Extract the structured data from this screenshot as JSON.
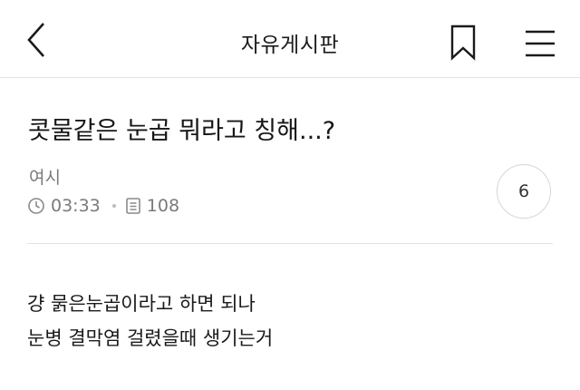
{
  "header": {
    "title": "자유게시판",
    "back_icon": "chevron-left-icon",
    "bookmark_icon": "bookmark-icon",
    "menu_icon": "hamburger-menu-icon"
  },
  "post": {
    "title": "콧물같은 눈곱 뭐라고 칭해...?",
    "author": "여시",
    "time": "03:33",
    "views": "108",
    "comment_count": "6",
    "body_lines": [
      "걍 묽은눈곱이라고 하면 되나",
      "눈병 결막염 걸렸을때 생기는거"
    ]
  },
  "colors": {
    "text": "#1a1a1a",
    "meta_text": "#7a7a7a",
    "divider": "#e2e2e2"
  }
}
